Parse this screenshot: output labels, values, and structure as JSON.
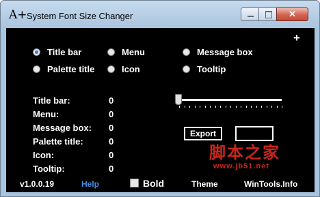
{
  "window": {
    "icon_text": "A+",
    "title": "System Font Size Changer",
    "minimize_glyph": "",
    "maximize_glyph": "",
    "close_glyph": "✕"
  },
  "add_button": "+",
  "radios": [
    {
      "label": "Title bar",
      "selected": true
    },
    {
      "label": "Menu",
      "selected": false
    },
    {
      "label": "Message box",
      "selected": false
    },
    {
      "label": "Palette title",
      "selected": false
    },
    {
      "label": "Icon",
      "selected": false
    },
    {
      "label": "Tooltip",
      "selected": false
    }
  ],
  "stats": [
    {
      "label": "Title bar:",
      "value": "0"
    },
    {
      "label": "Menu:",
      "value": "0"
    },
    {
      "label": "Message box:",
      "value": "0"
    },
    {
      "label": "Palette title:",
      "value": "0"
    },
    {
      "label": "Icon:",
      "value": "0"
    },
    {
      "label": "Tooltip:",
      "value": "0"
    }
  ],
  "slider": {
    "level": 0
  },
  "export_label": "Export",
  "value_box": "",
  "footer": {
    "version": "v1.0.0.19",
    "help": "Help",
    "bold_label": "Bold",
    "theme": "Theme",
    "site": "WinTools.Info"
  },
  "watermark": {
    "text": "脚本之家",
    "url": "www.jb51.net"
  },
  "colors": {
    "background": "#000000",
    "text": "#ffffff",
    "help_link": "#3b8ee6",
    "radio_selected": "#3a7bd5",
    "watermark": "#c8261c",
    "close_button": "#c24b36"
  }
}
